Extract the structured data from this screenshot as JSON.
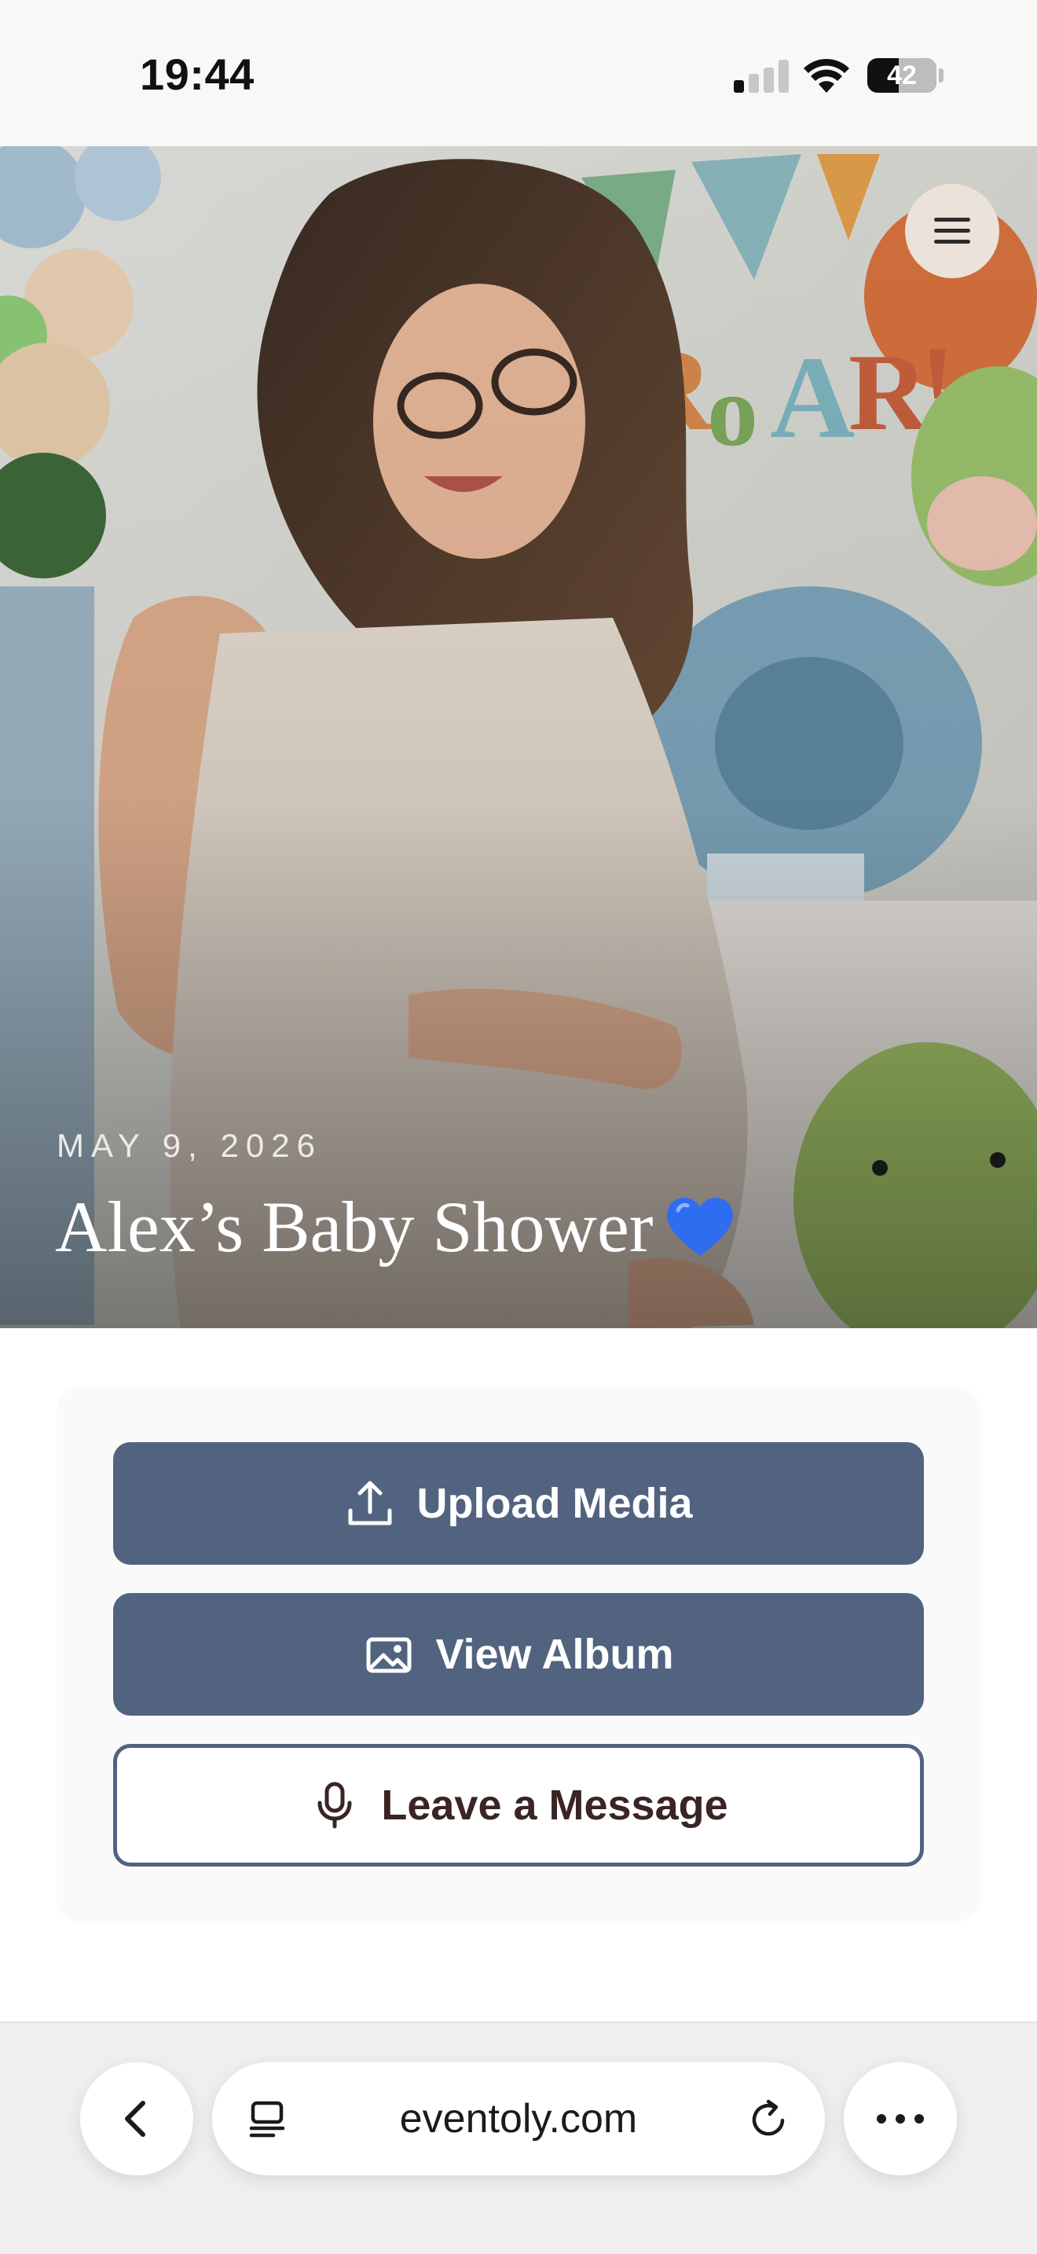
{
  "status_bar": {
    "time": "19:44",
    "battery_level": "42",
    "battery_percent": 42,
    "signal_bars_active": 1,
    "signal_bars_total": 4
  },
  "hero": {
    "date": "MAY 9, 2026",
    "title": "Alex’s Baby Shower",
    "title_emoji_icon": "blue-heart-icon",
    "menu_icon": "hamburger-menu-icon"
  },
  "actions": {
    "upload_label": "Upload Media",
    "upload_icon": "upload-icon",
    "album_label": "View Album",
    "album_icon": "image-icon",
    "message_label": "Leave a Message",
    "message_icon": "microphone-icon"
  },
  "browser": {
    "url": "eventoly.com",
    "back_icon": "chevron-left-icon",
    "tabs_icon": "page-menu-icon",
    "reload_icon": "reload-icon",
    "more_icon": "more-dots-icon"
  },
  "colors": {
    "primary": "#52637f",
    "message_text": "#3a2424",
    "menu_button_bg": "#ebe2da",
    "heart": "#2f6df0"
  }
}
